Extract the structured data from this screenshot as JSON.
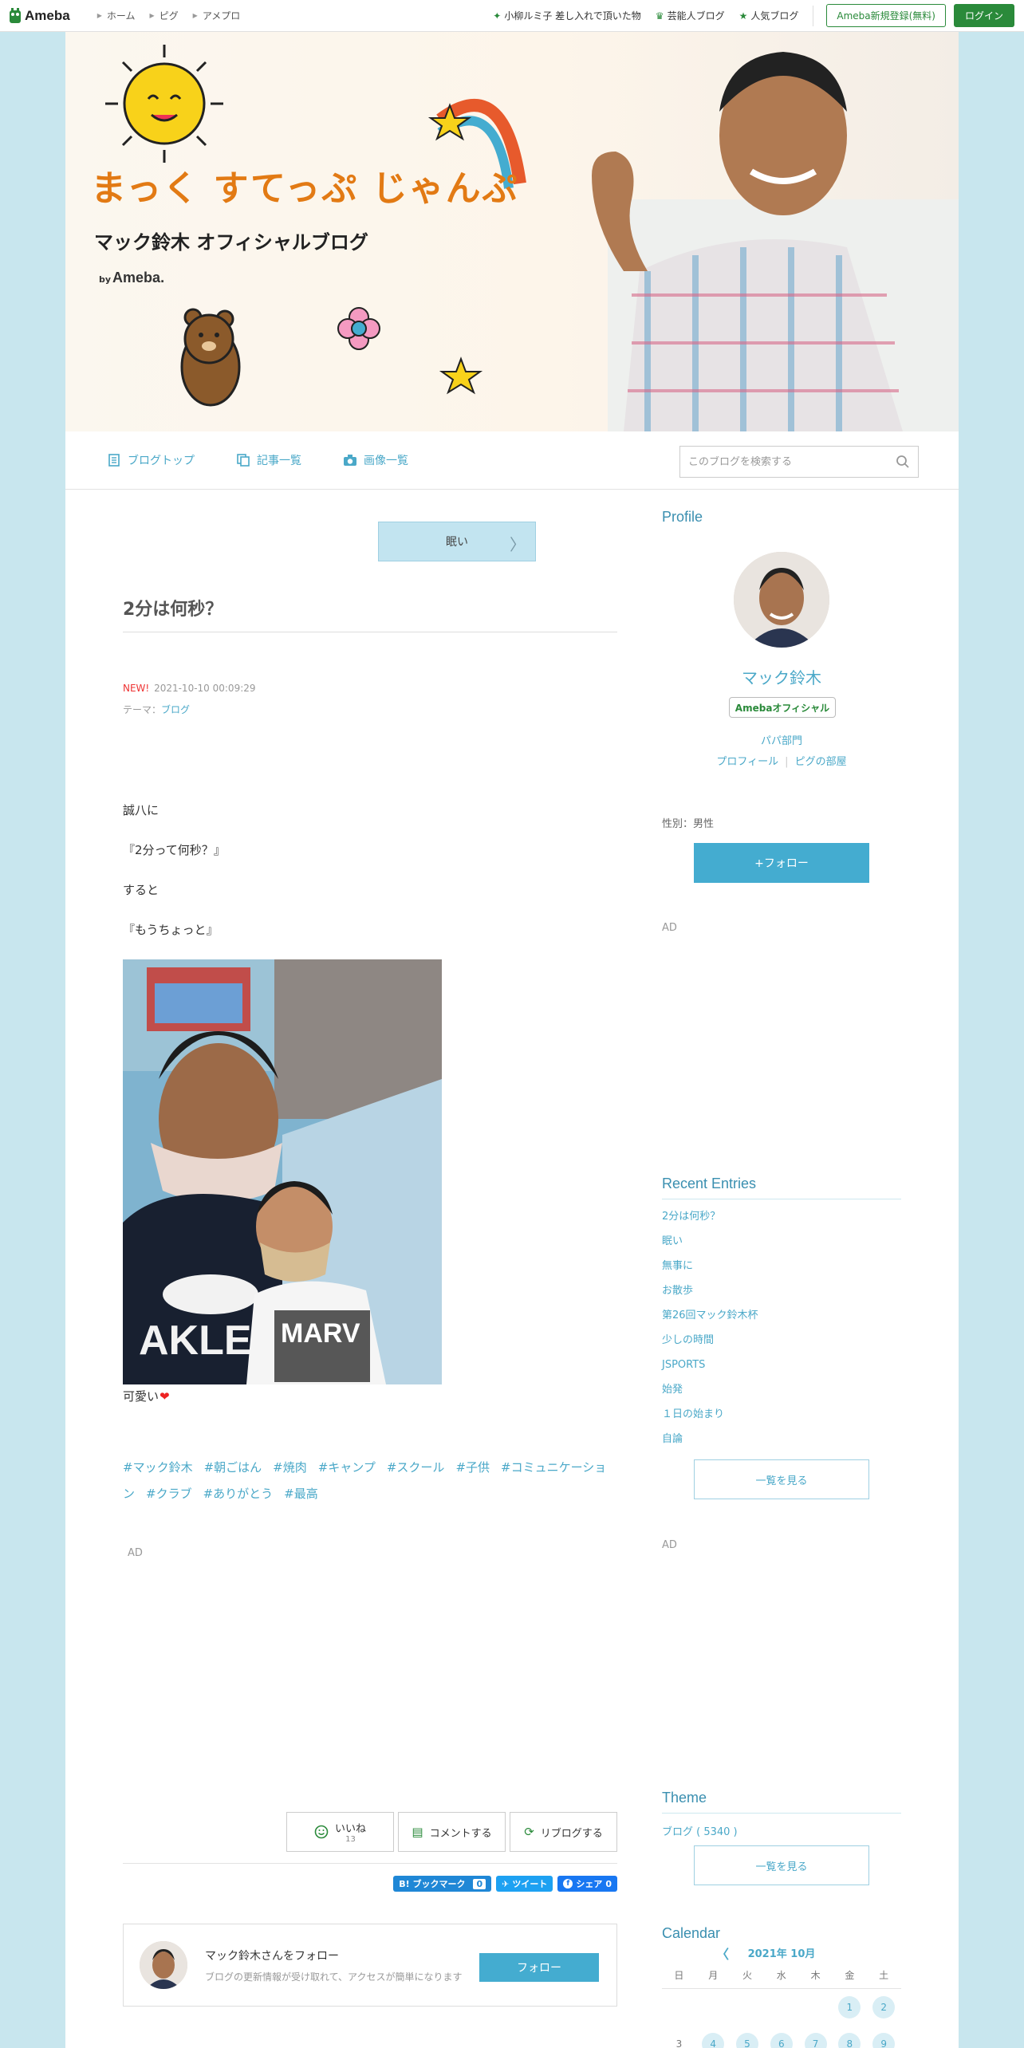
{
  "topbar": {
    "logo": "Ameba",
    "nav": [
      "ホーム",
      "ピグ",
      "アメプロ"
    ],
    "links": [
      "小柳ルミ子 差し入れで頂いた物",
      "芸能人ブログ",
      "人気ブログ"
    ],
    "register": "Ameba新規登録(無料)",
    "login": "ログイン"
  },
  "header": {
    "title": "まっく すてっぷ じゃんぷ",
    "subtitle": "マック鈴木 オフィシャルブログ",
    "by": "by",
    "brand": "Ameba."
  },
  "gnav": {
    "items": [
      "ブログトップ",
      "記事一覧",
      "画像一覧"
    ],
    "search_placeholder": "このブログを検索する"
  },
  "article": {
    "prev_entry": "眠い",
    "title": "2分は何秒？",
    "new_label": "NEW!",
    "datetime": "2021-10-10 00:09:29",
    "theme_label": "テーマ：",
    "theme": "ブログ",
    "lines": [
      "誠八に",
      "『2分って何秒？』",
      "すると",
      "『もうちょっと』"
    ],
    "caption": "可愛い",
    "hashtags": [
      "#マック鈴木",
      "#朝ごはん",
      "#焼肉",
      "#キャンプ",
      "#スクール",
      "#子供",
      "#コミュニケーション",
      "#クラブ",
      "#ありがとう",
      "#最高"
    ],
    "ad": "AD",
    "like_label": "いいね",
    "like_count": "13",
    "comment_label": "コメントする",
    "reblog_label": "リブログする",
    "hatena_label": "B! ブックマーク",
    "hatena_count": "0",
    "tweet_label": "ツイート",
    "fb_label": "シェア",
    "fb_count": "0",
    "follow_title": "マック鈴木さんをフォロー",
    "follow_sub": "ブログの更新情報が受け取れて、アクセスが簡単になります",
    "follow_btn": "フォロー"
  },
  "sidebar": {
    "profile_heading": "Profile",
    "name": "マック鈴木",
    "badge": "Amebaオフィシャル",
    "category": "パパ部門",
    "links": [
      "プロフィール",
      "ピグの部屋"
    ],
    "gender": "性別：男性",
    "follow_btn": "+フォロー",
    "ad": "AD",
    "recent_heading": "Recent Entries",
    "recent": [
      "2分は何秒？",
      "眠い",
      "無事に",
      "お散歩",
      "第26回マック鈴木杯",
      "少しの時間",
      "JSPORTS",
      "始発",
      "１日の始まり",
      "自論"
    ],
    "more": "一覧を見る",
    "theme_heading": "Theme",
    "theme_item": "ブログ ( 5340 )",
    "calendar_heading": "Calendar",
    "calendar_month": "2021年 10月",
    "weekdays": [
      "日",
      "月",
      "火",
      "水",
      "木",
      "金",
      "土"
    ],
    "calendar_rows": [
      [
        "",
        "",
        "",
        "",
        "",
        "1",
        "2"
      ],
      [
        "3",
        "4",
        "5",
        "6",
        "7",
        "8",
        "9"
      ]
    ]
  }
}
